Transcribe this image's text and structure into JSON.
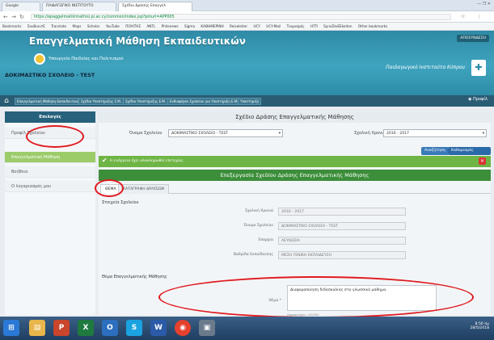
{
  "browser": {
    "tabs": [
      {
        "label": "Google"
      },
      {
        "label": "ΠΑΙΔΑΓΩΓΙΚΟ ΙΝΣΤΙΤΟΥΤΟ"
      },
      {
        "label": "Σχέδιο Δράσης Επαγγελ"
      }
    ],
    "url": "https://epaggelmatikimathisi.pi.ac.cy/common/index.jsp?pmurl=APP005",
    "bookmarks": [
      "Bookmarks",
      "ΣουΒιοντΕ",
      "Translate",
      "Maps",
      "Scholar",
      "YouTube",
      "ΠΟΛΙΤΗΣ",
      "ANTL",
      "Philenews",
      "Sigma",
      "KAΘΗΜΕΡΙΝΗ",
      "Reiseleiter",
      "UCY",
      "UCY-Mail",
      "Τουρισμός",
      "ΗΤΠ",
      "SynoDivEEkeiton",
      "Other bookmarks"
    ]
  },
  "header": {
    "site_title": "Επαγγελματική Μάθηση Εκπαιδευτικών",
    "ministry": "Υπουργείο Παιδείας και Πολιτισμού",
    "school": "ΔΟΚΙΜΑΣΤΙΚΟ ΣΧΟΛΕΙΟ - TEST",
    "institute": "Παιδαγωγικό Ινστιτούτο Κύπρου",
    "logout": "ΑΠΟΣΥΝΔΕΣΗ"
  },
  "topmenu": {
    "items": [
      "Επαγγελματική Μάθηση Εκπαιδευτικών",
      "Σχέδιο Υποστήριξης Σ.Μ.",
      "Σχέδιο Υποστήριξης Ε.Μ.",
      "Ενδιαφέρον Σχολείου για Υποστήριξη Ε.Μ.",
      "Υποστήριξη"
    ],
    "profile": "Προφίλ"
  },
  "sidebar": {
    "header": "Επιλογές",
    "items": [
      "Προφίλ Σχολείου",
      "Επαγγελματική Μάθηση",
      "Βοήθεια",
      "Ο λογαριασμός μου"
    ]
  },
  "main": {
    "title": "Σχέδιο Δράσης Επαγγελματικής Μάθησης",
    "school_label": "Όνομα Σχολείου",
    "school_value": "ΔΟΚΙΜΑΣΤΙΚΟ ΣΧΟΛΕΙΟ - TEST",
    "year_label": "Σχολική Χρονιά",
    "year_value": "2016 - 2017",
    "search_btn": "Αναζήτηση",
    "clear_btn": "Καθαρισμός Πεδίων",
    "success_msg": "Η ενέργεια έχει ολοκληρωθεί επιτυχώς.",
    "panel_title": "Επεξεργασία Σχεδίου Δράσης Επαγγελματικής Μάθησης",
    "tabs": [
      "ΘΕΜΑ",
      "ΚΑΤΑΓΡΑΦΗ ΔΡΑΣΕΩΝ"
    ],
    "section_info": "Στοιχεία Σχολείου",
    "fields": [
      {
        "label": "Σχολική Χρονιά",
        "value": "2016 - 2017"
      },
      {
        "label": "Όνομα Σχολείου",
        "value": "ΔΟΚΙΜΑΣΤΙΚΟ ΣΧΟΛΕΙΟ - TEST"
      },
      {
        "label": "Επαρχία",
        "value": "ΛΕΥΚΩΣΙΑ"
      },
      {
        "label": "Βαθμίδα Εκπαίδευσης",
        "value": "ΜΕΣΗ ΓΕΝΙΚΗ ΕΚΠΑΙΔΕΥΣΗ"
      }
    ],
    "section_theme": "Θέμα Επαγγελματικής Μάθησης",
    "textarea_label": "Θέμα *",
    "textarea_value": "Διαφοροποίηση διδασκαλίας στο γλωσσικό μάθημα.",
    "charcount": "Χαρακτήρες: 45/300"
  },
  "taskbar": {
    "apps": [
      {
        "icon": "windows-icon",
        "color": "#2b79d6"
      },
      {
        "icon": "file-explorer-icon",
        "color": "#e8b64a"
      },
      {
        "icon": "powerpoint-icon",
        "color": "#c9452b"
      },
      {
        "icon": "excel-icon",
        "color": "#1f7a3f"
      },
      {
        "icon": "outlook-icon",
        "color": "#2c6fbf"
      },
      {
        "icon": "skype-icon",
        "color": "#1aa3e0"
      },
      {
        "icon": "word-icon",
        "color": "#2a5aa8"
      },
      {
        "icon": "chrome-icon",
        "color": "#e6412d"
      },
      {
        "icon": "app-icon",
        "color": "#6c7b8c"
      }
    ],
    "time": "8:56 πμ",
    "date": "28/5/2018"
  },
  "colors": {
    "header": "#3fa4bf",
    "menu": "#2a5c74",
    "success": "#6fb545",
    "panel": "#3c8e3a",
    "annotation": "#e0191f"
  }
}
